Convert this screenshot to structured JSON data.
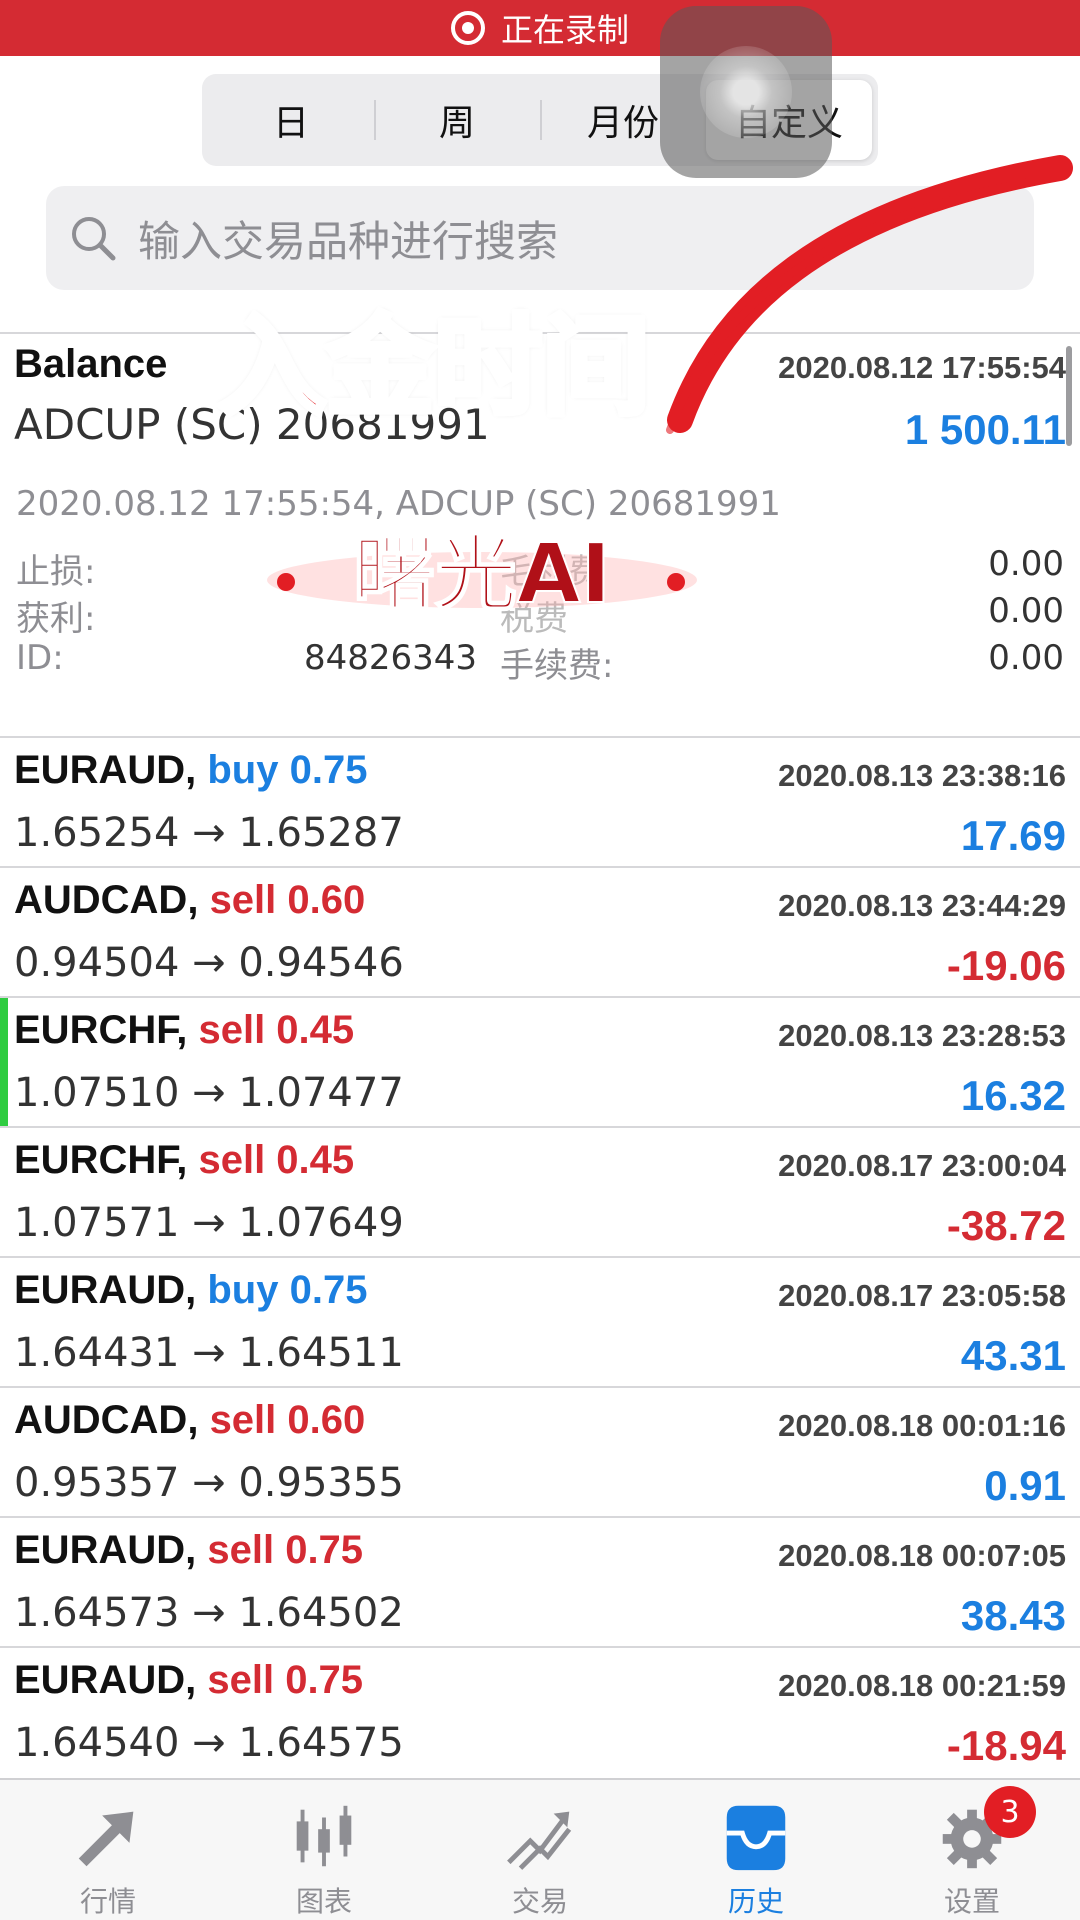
{
  "recording_bar": {
    "label": "正在录制"
  },
  "segmented": {
    "tabs": [
      {
        "label": "日"
      },
      {
        "label": "周"
      },
      {
        "label": "月份"
      },
      {
        "label": "自定义"
      }
    ],
    "active_index": 3
  },
  "search": {
    "placeholder": "输入交易品种进行搜索"
  },
  "overlay": {
    "title": "入金时间",
    "watermark": "曙光AI"
  },
  "balance": {
    "title": "Balance",
    "account": "ADCUP (SC) 20681991",
    "date": "2020.08.12 17:55:54",
    "amount": "1 500.11",
    "detail": "2020.08.12 17:55:54, ADCUP (SC) 20681991",
    "stop_loss_label": "止损:",
    "stop_loss_value": "0.00",
    "take_profit_label": "获利:",
    "take_profit_value": "0.00",
    "id_label": "ID:",
    "id_value": "84826343",
    "fee_label": "手续费:",
    "fee_value": "0.00",
    "swap_label_partial": "毛利费",
    "tax_label_partial": "税费"
  },
  "trades": [
    {
      "symbol": "EURAUD,",
      "side": "buy",
      "side_label": "buy 0.75",
      "prices": "1.65254 → 1.65287",
      "time": "2020.08.13 23:38:16",
      "profit": "17.69",
      "sign": "pos",
      "marked": false
    },
    {
      "symbol": "AUDCAD,",
      "side": "sell",
      "side_label": "sell 0.60",
      "prices": "0.94504 → 0.94546",
      "time": "2020.08.13 23:44:29",
      "profit": "-19.06",
      "sign": "neg",
      "marked": false
    },
    {
      "symbol": "EURCHF,",
      "side": "sell",
      "side_label": "sell 0.45",
      "prices": "1.07510 → 1.07477",
      "time": "2020.08.13 23:28:53",
      "profit": "16.32",
      "sign": "pos",
      "marked": true
    },
    {
      "symbol": "EURCHF,",
      "side": "sell",
      "side_label": "sell 0.45",
      "prices": "1.07571 → 1.07649",
      "time": "2020.08.17 23:00:04",
      "profit": "-38.72",
      "sign": "neg",
      "marked": false
    },
    {
      "symbol": "EURAUD,",
      "side": "buy",
      "side_label": "buy 0.75",
      "prices": "1.64431 → 1.64511",
      "time": "2020.08.17 23:05:58",
      "profit": "43.31",
      "sign": "pos",
      "marked": false
    },
    {
      "symbol": "AUDCAD,",
      "side": "sell",
      "side_label": "sell 0.60",
      "prices": "0.95357 → 0.95355",
      "time": "2020.08.18 00:01:16",
      "profit": "0.91",
      "sign": "pos",
      "marked": false
    },
    {
      "symbol": "EURAUD,",
      "side": "sell",
      "side_label": "sell 0.75",
      "prices": "1.64573 → 1.64502",
      "time": "2020.08.18 00:07:05",
      "profit": "38.43",
      "sign": "pos",
      "marked": false
    },
    {
      "symbol": "EURAUD,",
      "side": "sell",
      "side_label": "sell 0.75",
      "prices": "1.64540 → 1.64575",
      "time": "2020.08.18 00:21:59",
      "profit": "-18.94",
      "sign": "neg",
      "marked": false
    }
  ],
  "tabbar": {
    "items": [
      {
        "label": "行情",
        "icon": "quotes-icon"
      },
      {
        "label": "图表",
        "icon": "chart-icon"
      },
      {
        "label": "交易",
        "icon": "trade-icon"
      },
      {
        "label": "历史",
        "icon": "history-icon"
      },
      {
        "label": "设置",
        "icon": "settings-icon"
      }
    ],
    "active_index": 3,
    "settings_badge": "3"
  },
  "colors": {
    "accent": "#1b7fe0",
    "sell": "#d42b33",
    "recording": "#d42b33",
    "marker": "#2ecc40"
  }
}
